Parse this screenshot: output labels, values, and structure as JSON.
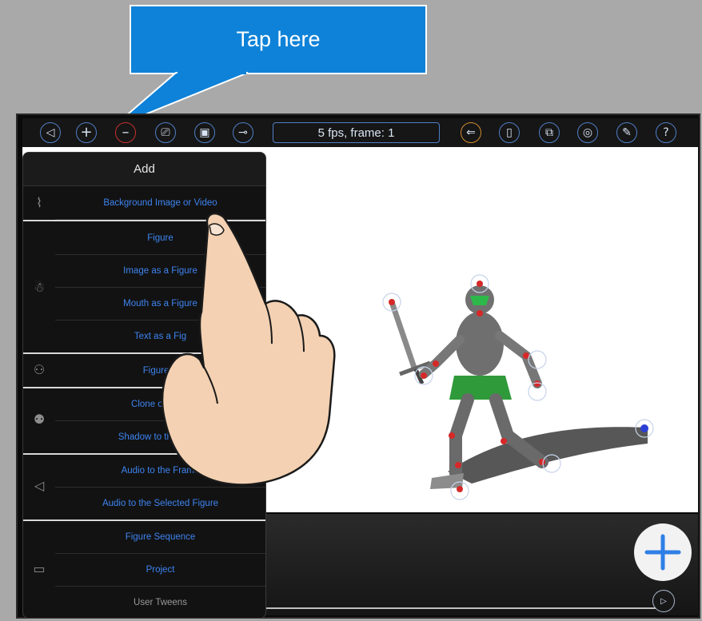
{
  "callout": {
    "text": "Tap here"
  },
  "toolbar": {
    "status_text": "5 fps, frame: 1",
    "buttons": [
      {
        "icon": "back-icon",
        "glyph": "◁"
      },
      {
        "icon": "add-icon",
        "glyph": "+"
      },
      {
        "icon": "remove-icon",
        "glyph": "–"
      },
      {
        "icon": "camera-icon",
        "glyph": "⎚"
      },
      {
        "icon": "photo-icon",
        "glyph": "▣"
      },
      {
        "icon": "key-icon",
        "glyph": "⊸"
      },
      {
        "icon": "onion-skin-icon",
        "glyph": "⇐"
      },
      {
        "icon": "clipboard-icon",
        "glyph": "▯"
      },
      {
        "icon": "export-icon",
        "glyph": "⧉"
      },
      {
        "icon": "settings-icon",
        "glyph": "◎"
      },
      {
        "icon": "tools-icon",
        "glyph": "✎"
      },
      {
        "icon": "help-icon",
        "glyph": "?"
      }
    ]
  },
  "menu": {
    "title": "Add",
    "items": [
      "Background Image or Video",
      "Figure",
      "Image as a Figure",
      "Mouth as a Figure",
      "Text as a Figure",
      "Figure Sequence",
      "Clone of the Selected Figure",
      "Shadow to the Selected Figure",
      "Audio to the Frame",
      "Audio to the Selected Figure",
      "Figure Sequence",
      "Project",
      "User Tweens"
    ],
    "visible_items": [
      "Background Image or Video",
      "Figure",
      "Image as a Figure",
      "Mouth as a Figure",
      "Text as a Fig",
      "Figure S",
      "Clone of the S",
      "Shadow to the Selec",
      "Audio to the Frame",
      "Audio to the Selected Figure",
      "Figure Sequence",
      "Project",
      "User Tweens"
    ]
  },
  "colors": {
    "accent": "#3e84f0",
    "callout": "#0e82d8",
    "remove": "#c3322f",
    "onion": "#d18a2d"
  }
}
